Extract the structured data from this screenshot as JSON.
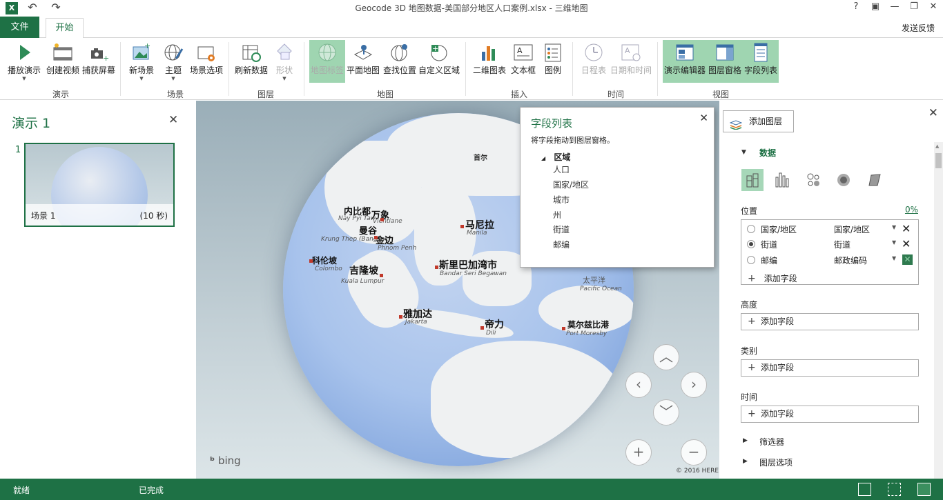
{
  "window": {
    "title": "Geocode 3D 地图数据-美国部分地区人口案例.xlsx - 三维地图",
    "app_icon": "X",
    "controls": [
      "?",
      "▣",
      "—",
      "❐",
      "✕"
    ]
  },
  "tabs": {
    "file": "文件",
    "home": "开始",
    "feedback": "发送反馈"
  },
  "ribbon": {
    "tour": {
      "label": "演示",
      "buttons": [
        "播放演示",
        "创建视频",
        "捕获屏幕"
      ]
    },
    "scene": {
      "label": "场景",
      "buttons": [
        "新场景",
        "主题",
        "场景选项"
      ]
    },
    "layer": {
      "label": "图层",
      "buttons": [
        "刷新数据",
        "形状"
      ]
    },
    "map": {
      "label": "地图",
      "buttons": [
        "地图标签",
        "平面地图",
        "查找位置",
        "自定义区域"
      ]
    },
    "insert": {
      "label": "插入",
      "buttons": [
        "二维图表",
        "文本框",
        "图例"
      ]
    },
    "time": {
      "label": "时间",
      "buttons": [
        "日程表",
        "日期和时间"
      ]
    },
    "view": {
      "label": "视图",
      "buttons": [
        "演示编辑器",
        "图层窗格",
        "字段列表"
      ]
    }
  },
  "tour_pane": {
    "title": "演示 1",
    "scene_number": "1",
    "scene_name": "场景 1",
    "scene_duration": "(10 秒)"
  },
  "map": {
    "cities": [
      {
        "zh": "内比都",
        "en": "Nay Pyi Taw"
      },
      {
        "zh": "万象",
        "en": "Vientiane"
      },
      {
        "zh": "曼谷",
        "en": "Krung Thep (Bangkok)"
      },
      {
        "zh": "金边",
        "en": "Phnom Penh"
      },
      {
        "zh": "马尼拉",
        "en": "Manila"
      },
      {
        "zh": "科伦坡",
        "en": "Colombo"
      },
      {
        "zh": "吉隆坡",
        "en": "Kuala Lumpur"
      },
      {
        "zh": "斯里巴加湾市",
        "en": "Bandar Seri Begawan"
      },
      {
        "zh": "雅加达",
        "en": "Jakarta"
      },
      {
        "zh": "帝力",
        "en": "Dili"
      },
      {
        "zh": "莫尔兹比港",
        "en": "Port Moresby"
      },
      {
        "zh": "首尔",
        "en": ""
      },
      {
        "zh": "太平洋",
        "en": "Pacific Ocean"
      }
    ],
    "bing": "bing",
    "copyright": "© 2016 HERE"
  },
  "field_list": {
    "title": "字段列表",
    "hint": "将字段拖动到图层窗格。",
    "group": "区域",
    "fields": [
      "人口",
      "国家/地区",
      "城市",
      "州",
      "街道",
      "邮编"
    ]
  },
  "layer_pane": {
    "add_layer": "添加图层",
    "data_section": "数据",
    "location_label": "位置",
    "location_pct": "0%",
    "locations": [
      {
        "field": "国家/地区",
        "type": "国家/地区",
        "selected": false
      },
      {
        "field": "街道",
        "type": "街道",
        "selected": true
      },
      {
        "field": "邮编",
        "type": "邮政编码",
        "selected": false
      }
    ],
    "add_field": "添加字段",
    "height_label": "高度",
    "category_label": "类别",
    "time_label": "时间",
    "filters": "筛选器",
    "layer_options": "图层选项"
  },
  "status": {
    "ready": "就绪",
    "complete": "已完成"
  }
}
